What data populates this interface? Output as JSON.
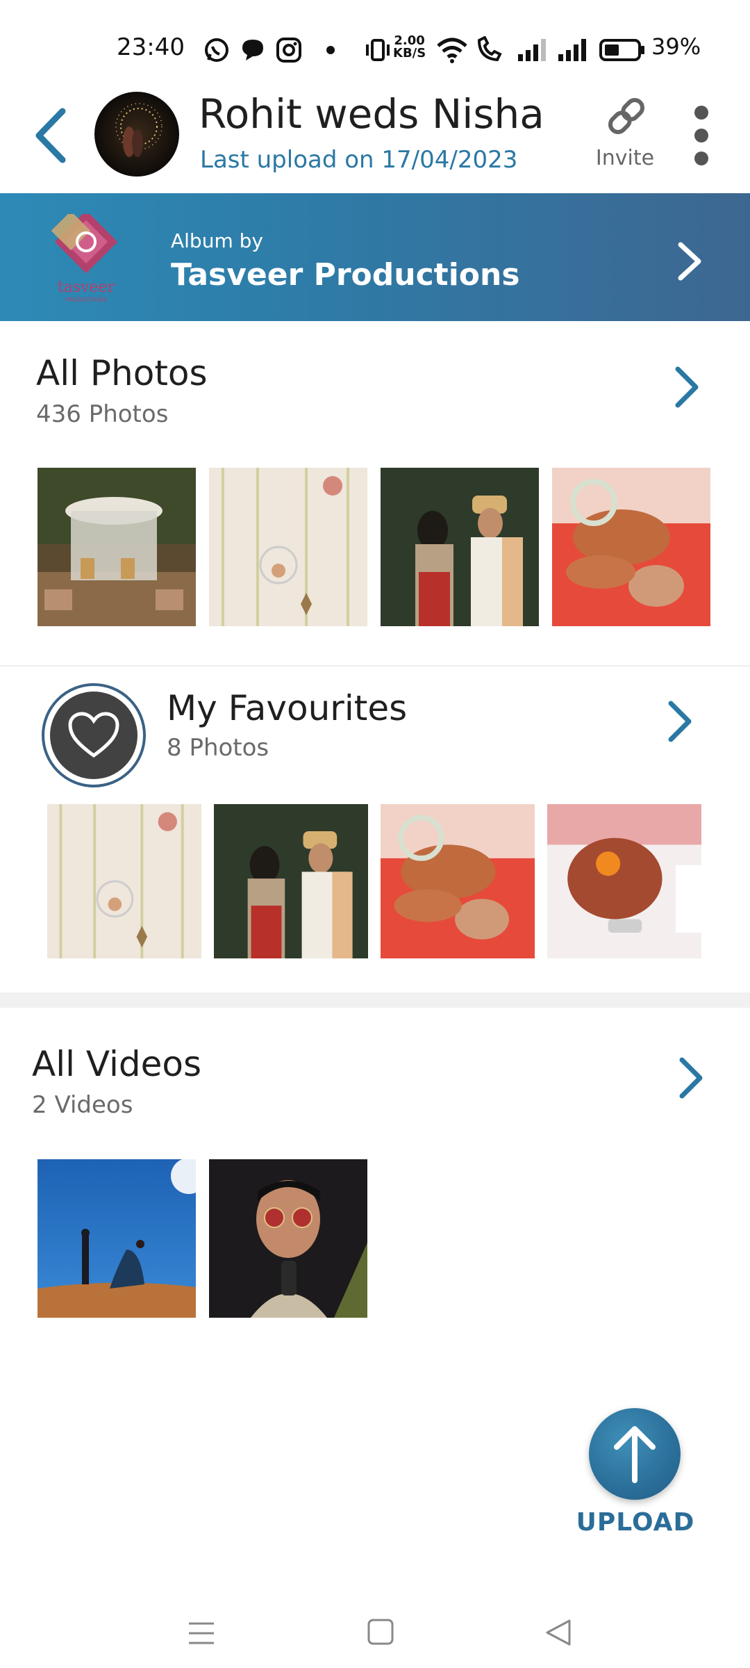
{
  "status_bar": {
    "time": "23:40",
    "net_speed_value": "2.00",
    "net_speed_unit": "KB/S",
    "battery_percent": "39%",
    "icons": [
      "whatsapp-icon",
      "chat-bubble-icon",
      "instagram-icon",
      "dot-icon",
      "vibrate-icon",
      "wifi-icon",
      "call-icon",
      "signal-icon",
      "signal-icon",
      "battery-icon"
    ]
  },
  "header": {
    "title": "Rohit weds Nisha",
    "subtitle": "Last upload on 17/04/2023",
    "invite_label": "Invite"
  },
  "banner": {
    "album_by": "Album by",
    "producer": "Tasveer Productions",
    "logo_text": "tasveer",
    "logo_subtext": "PRODUCTIONS"
  },
  "all_photos": {
    "title": "All Photos",
    "count": "436 Photos",
    "thumbnails": [
      "wedding-mandap-thumb",
      "hanging-decor-thumb",
      "couple-garland-thumb",
      "mehndi-hands-thumb"
    ]
  },
  "favourites": {
    "title": "My Favourites",
    "count": "8 Photos",
    "thumbnails": [
      "hanging-decor-thumb",
      "couple-garland-thumb",
      "mehndi-hands-thumb",
      "henna-flower-thumb"
    ]
  },
  "all_videos": {
    "title": "All Videos",
    "count": "2 Videos",
    "thumbnails": [
      "desert-couple-thumb",
      "sunglasses-man-thumb"
    ]
  },
  "upload": {
    "label": "UPLOAD"
  },
  "colors": {
    "accent": "#2a78a4",
    "banner_start": "#2d8ab6",
    "banner_end": "#3d6791"
  }
}
